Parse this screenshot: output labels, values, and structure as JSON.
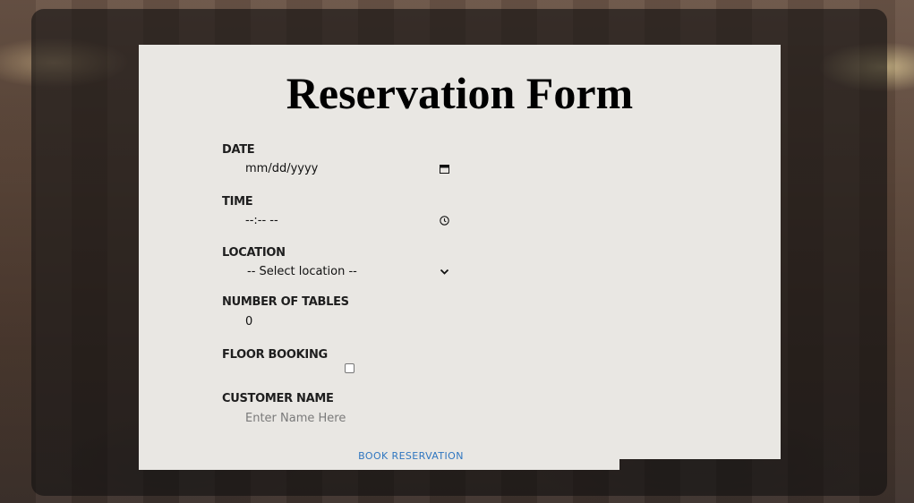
{
  "form": {
    "title": "Reservation Form",
    "fields": {
      "date": {
        "label": "DATE",
        "value": "mm/dd/yyyy",
        "icon": "calendar-icon"
      },
      "time": {
        "label": "TIME",
        "value": "--:-- --",
        "icon": "clock-icon"
      },
      "location": {
        "label": "LOCATION",
        "value": "-- Select location --",
        "icon": "chevron-down-icon"
      },
      "tables": {
        "label": "NUMBER OF TABLES",
        "value": "0"
      },
      "floor_booking": {
        "label": "FLOOR BOOKING",
        "checked": false
      },
      "customer_name": {
        "label": "CUSTOMER NAME",
        "placeholder": "Enter Name Here"
      }
    },
    "submit_label": "BOOK RESERVATION"
  }
}
